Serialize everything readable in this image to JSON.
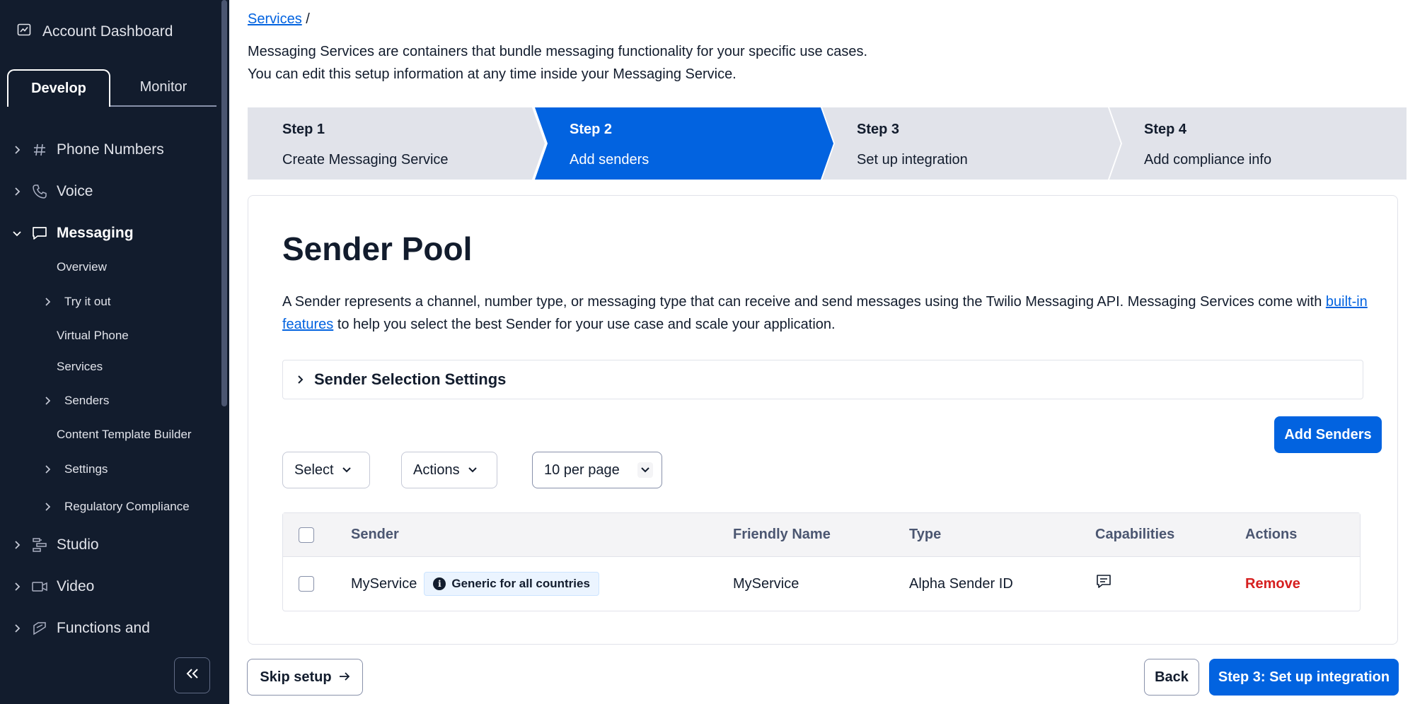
{
  "sidebar": {
    "dashboard_label": "Account Dashboard",
    "tabs": [
      "Develop",
      "Monitor"
    ],
    "nav": [
      {
        "label": "Phone Numbers",
        "icon": "hash-icon"
      },
      {
        "label": "Voice",
        "icon": "phone-icon"
      },
      {
        "label": "Messaging",
        "icon": "chat-icon"
      },
      {
        "label": "Studio",
        "icon": "studio-icon"
      },
      {
        "label": "Video",
        "icon": "video-icon"
      },
      {
        "label": "Functions and",
        "icon": "functions-icon"
      }
    ],
    "messaging_sub": {
      "overview": "Overview",
      "try_it_out": "Try it out",
      "virtual_phone": "Virtual Phone",
      "services": "Services",
      "senders": "Senders",
      "content_template_builder": "Content Template Builder",
      "settings": "Settings",
      "regulatory_compliance": "Regulatory Compliance"
    }
  },
  "breadcrumb": {
    "link": "Services",
    "separator": "/"
  },
  "intro": {
    "line1": "Messaging Services are containers that bundle messaging functionality for your specific use cases.",
    "line2": "You can edit this setup information at any time inside your Messaging Service."
  },
  "steps": [
    {
      "num": "Step 1",
      "name": "Create Messaging Service",
      "active": false
    },
    {
      "num": "Step 2",
      "name": "Add senders",
      "active": true
    },
    {
      "num": "Step 3",
      "name": "Set up integration",
      "active": false
    },
    {
      "num": "Step 4",
      "name": "Add compliance info",
      "active": false
    }
  ],
  "sender_pool": {
    "title": "Sender Pool",
    "desc_part1": "A Sender represents a channel, number type, or messaging type that can receive and send messages using the Twilio Messaging API. Messaging Services come with ",
    "desc_link": "built-in features",
    "desc_part2": " to help you select the best Sender for your use case and scale your application.",
    "settings_label": "Sender Selection Settings",
    "add_button": "Add Senders",
    "select_label": "Select",
    "actions_label": "Actions",
    "per_page": "10 per page",
    "columns": {
      "sender": "Sender",
      "friendly_name": "Friendly Name",
      "type": "Type",
      "capabilities": "Capabilities",
      "actions": "Actions"
    },
    "rows": [
      {
        "sender": "MyService",
        "badge": "Generic for all countries",
        "friendly_name": "MyService",
        "type": "Alpha Sender ID",
        "capability_icon": "sms-icon",
        "action": "Remove"
      }
    ]
  },
  "footer": {
    "skip": "Skip setup",
    "back": "Back",
    "next": "Step 3: Set up integration"
  },
  "colors": {
    "sidebar_bg": "#121c2d",
    "primary": "#0263e0",
    "step_inactive": "#e1e3ea",
    "danger": "#d61f1f"
  }
}
